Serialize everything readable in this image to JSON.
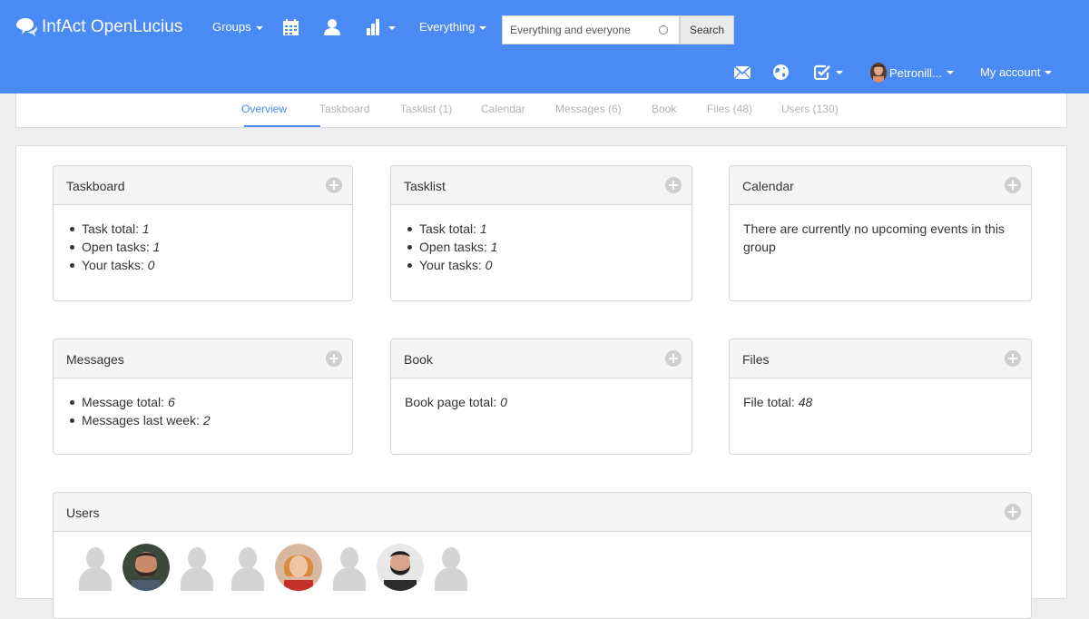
{
  "navbar": {
    "brand": "InfAct OpenLucius",
    "groups_label": "Groups",
    "scope_label": "Everything",
    "search_placeholder": "Everything and everyone",
    "search_button": "Search",
    "user_name": "Petronill...",
    "account_label": "My account",
    "icons": [
      "chat-logo-icon",
      "calendar-icon",
      "user-icon",
      "bar-chart-icon",
      "envelope-icon",
      "globe-icon",
      "checkbox-icon"
    ]
  },
  "tabs": [
    {
      "label": "Overview",
      "active": true
    },
    {
      "label": "Taskboard"
    },
    {
      "label": "Tasklist (1)"
    },
    {
      "label": "Calendar"
    },
    {
      "label": "Messages (6)"
    },
    {
      "label": "Book"
    },
    {
      "label": "Files (48)"
    },
    {
      "label": "Users (130)"
    }
  ],
  "cards": {
    "taskboard": {
      "title": "Taskboard",
      "items": [
        {
          "label": "Task total: ",
          "value": "1"
        },
        {
          "label": "Open tasks: ",
          "value": "1"
        },
        {
          "label": "Your tasks: ",
          "value": "0"
        }
      ]
    },
    "tasklist": {
      "title": "Tasklist",
      "items": [
        {
          "label": "Task total: ",
          "value": "1"
        },
        {
          "label": "Open tasks: ",
          "value": "1"
        },
        {
          "label": "Your tasks: ",
          "value": "0"
        }
      ]
    },
    "calendar": {
      "title": "Calendar",
      "text": "There are currently no upcoming events in this group"
    },
    "messages": {
      "title": "Messages",
      "items": [
        {
          "label": "Message total: ",
          "value": "6"
        },
        {
          "label": "Messages last week: ",
          "value": "2"
        }
      ]
    },
    "book": {
      "title": "Book",
      "label": "Book page total: ",
      "value": "0"
    },
    "files": {
      "title": "Files",
      "label": "File total: ",
      "value": "48"
    },
    "users": {
      "title": "Users",
      "avatars": [
        "placeholder",
        "photo-man-beard",
        "placeholder",
        "placeholder",
        "photo-woman",
        "placeholder",
        "photo-man-dark",
        "placeholder"
      ]
    }
  },
  "colors": {
    "navbar": "#4a8af4",
    "accent": "#4a8af4",
    "muted_tab": "#b3b3b3"
  }
}
